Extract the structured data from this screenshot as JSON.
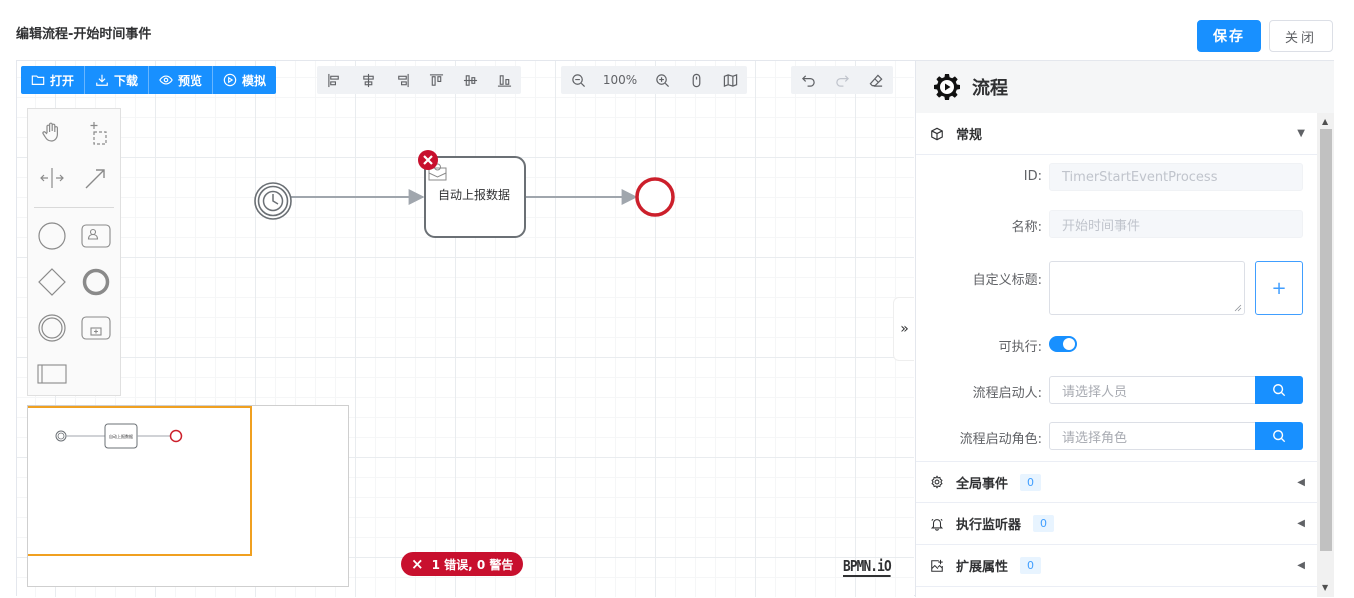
{
  "header": {
    "title": "编辑流程-开始时间事件",
    "save_label": "保存",
    "close_label": "关闭"
  },
  "toolbar": {
    "open_label": "打开",
    "download_label": "下载",
    "preview_label": "预览",
    "simulate_label": "模拟",
    "zoom_level": "100%"
  },
  "diagram": {
    "task_label": "自动上报数据",
    "minimap_task_label": "自动上报数据",
    "logo": "BPMN.iO"
  },
  "lint": {
    "error_icon": "×",
    "summary": "1 错误, 0 警告"
  },
  "panel": {
    "collapse_glyph": "»",
    "title": "流程",
    "general": {
      "title": "常规",
      "id_label": "ID:",
      "id_value": "TimerStartEventProcess",
      "name_label": "名称:",
      "name_value": "开始时间事件",
      "custom_title_label": "自定义标题:",
      "add_glyph": "+",
      "executable_label": "可执行:",
      "executable": true,
      "initiator_label": "流程启动人:",
      "initiator_placeholder": "请选择人员",
      "initiator_role_label": "流程启动角色:",
      "initiator_role_placeholder": "请选择角色"
    },
    "global_events": {
      "title": "全局事件",
      "count": "0"
    },
    "exec_listeners": {
      "title": "执行监听器",
      "count": "0"
    },
    "ext_props": {
      "title": "扩展属性",
      "count": "0"
    }
  },
  "colors": {
    "primary": "#1890ff",
    "error": "#c8102e",
    "end_event": "#cc1f2b",
    "minimap_viewport": "#f0a020"
  }
}
